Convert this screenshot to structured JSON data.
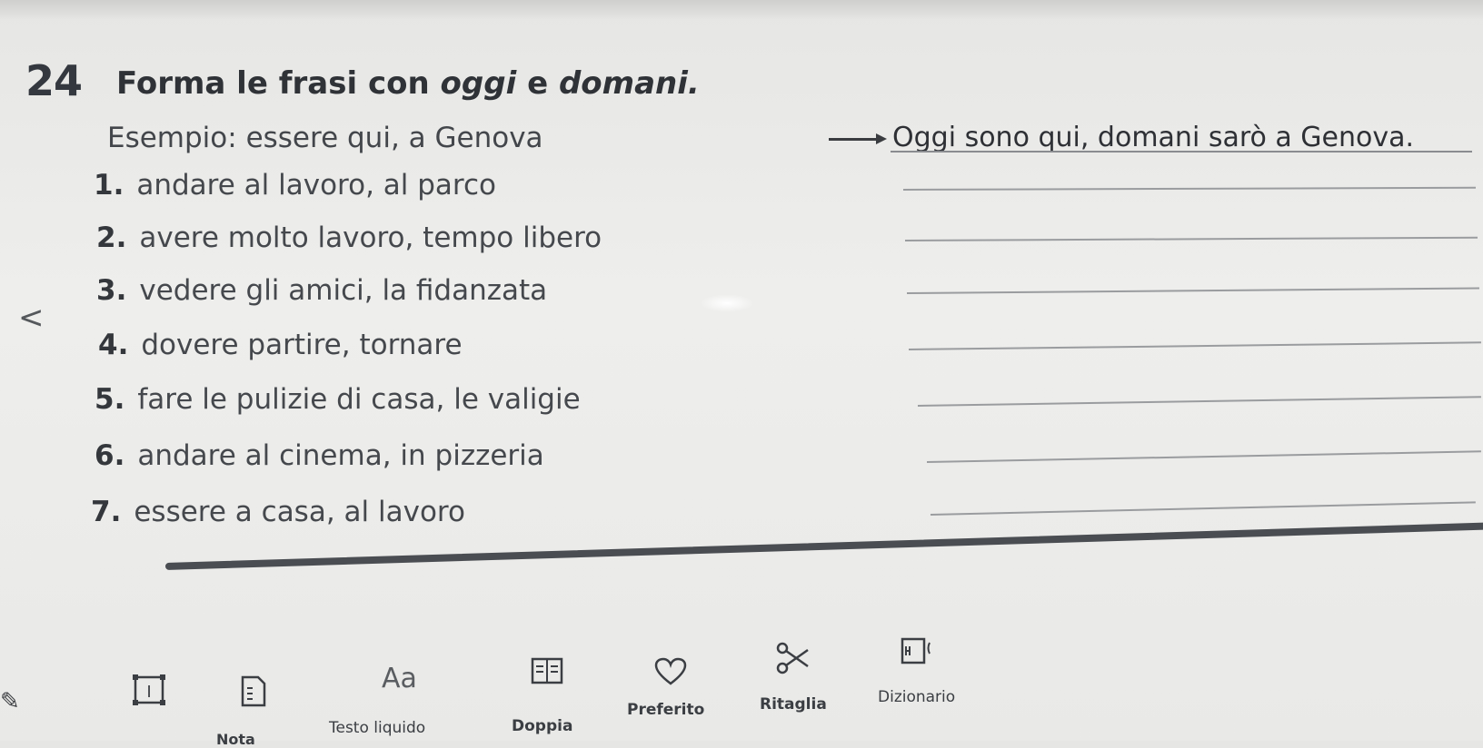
{
  "exercise": {
    "number": "24",
    "title_before": "Forma le frasi con ",
    "title_oggi": "oggi",
    "title_e": " e ",
    "title_domani": "domani.",
    "example_prompt": "Esempio: essere qui, a Genova",
    "example_answer": "Oggi sono qui, domani sarò a Genova.",
    "items": [
      {
        "num": "1.",
        "text": "andare al lavoro, al parco"
      },
      {
        "num": "2.",
        "text": "avere molto lavoro, tempo libero"
      },
      {
        "num": "3.",
        "text": "vedere gli amici, la fidanzata"
      },
      {
        "num": "4.",
        "text": "dovere partire, tornare"
      },
      {
        "num": "5.",
        "text": "fare le pulizie di casa, le valigie"
      },
      {
        "num": "6.",
        "text": "andare al cinema, in pizzeria"
      },
      {
        "num": "7.",
        "text": "essere a casa, al lavoro"
      }
    ]
  },
  "navigation": {
    "prev_label": "<"
  },
  "toolbar": {
    "text_size_glyph": "Aa",
    "tools": [
      {
        "name": "nota",
        "label": "Nota",
        "icon": "text-frame-icon"
      },
      {
        "name": "testo-liquido",
        "label": "Testo liquido",
        "icon": "document-icon"
      },
      {
        "name": "doppia",
        "label": "Doppia",
        "icon": "double-page-icon"
      },
      {
        "name": "preferito",
        "label": "Preferito",
        "icon": "heart-icon"
      },
      {
        "name": "ritaglia",
        "label": "Ritaglia",
        "icon": "scissors-icon"
      },
      {
        "name": "dizionario",
        "label": "Dizionario",
        "icon": "dictionary-icon"
      }
    ]
  },
  "colors": {
    "text": "#3a3c40",
    "background": "#eeeeec",
    "rule": "#4a4d52"
  }
}
